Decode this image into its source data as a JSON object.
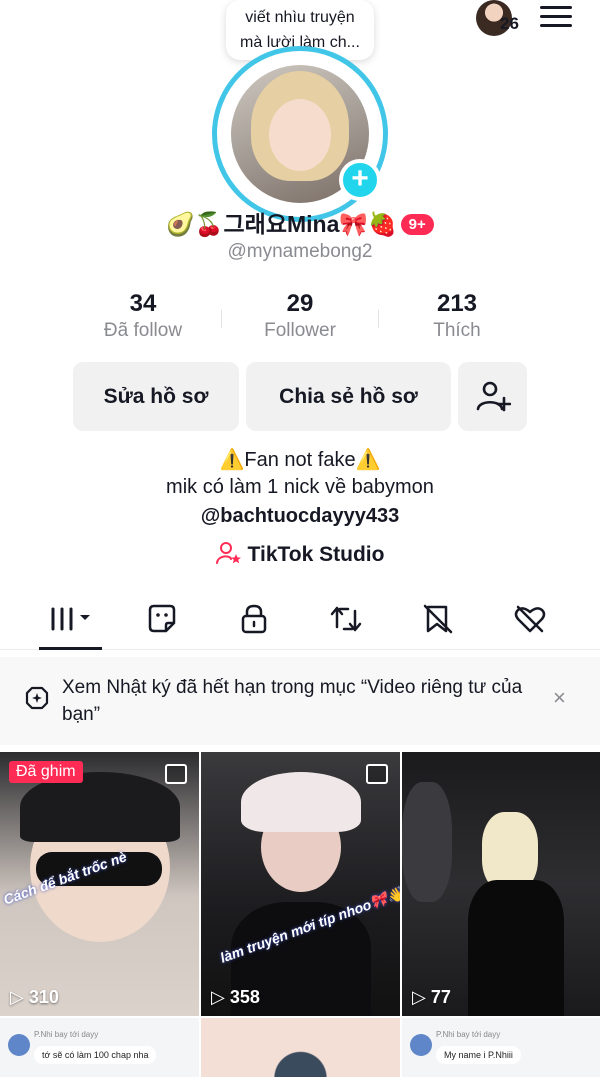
{
  "header": {
    "note_line1": "viết nhìu truyện",
    "note_line2": "mà lười làm ch...",
    "friend_count": "26"
  },
  "profile": {
    "display_name": "🥑🍒그래요Mina🎀🍓",
    "badge": "9+",
    "username": "@mynamebong2"
  },
  "stats": [
    {
      "value": "34",
      "label": "Đã follow"
    },
    {
      "value": "29",
      "label": "Follower"
    },
    {
      "value": "213",
      "label": "Thích"
    }
  ],
  "buttons": {
    "edit": "Sửa hồ sơ",
    "share": "Chia sẻ hồ sơ"
  },
  "bio": {
    "line1": "⚠️Fan not fake⚠️",
    "line2": "mik có làm 1 nick  về babymon",
    "line3": "@bachtuocdayyy433"
  },
  "studio": "TikTok Studio",
  "notice": {
    "text": "Xem Nhật ký đã hết hạn trong mục “Video riêng tư của bạn”",
    "close": "×"
  },
  "videos": [
    {
      "pinned": "Đã ghim",
      "views": "310",
      "caption": "Cách để bắt trốc nè",
      "has_photo_icon": true
    },
    {
      "views": "358",
      "caption": "làm truyện mới típ nhoo🎀👋",
      "has_photo_icon": true
    },
    {
      "views": "77"
    }
  ],
  "bottom_row": [
    {
      "commenter": "P.Nhi bay tới dayy",
      "comment": "tớ sẽ có làm 100 chap nha"
    },
    {},
    {
      "commenter": "P.Nhi bay tới dayy",
      "comment": "My name i P.Nhiii"
    }
  ],
  "colors": {
    "accent": "#fe2c55",
    "ring": "#41c6e8",
    "add": "#20d5ec"
  }
}
